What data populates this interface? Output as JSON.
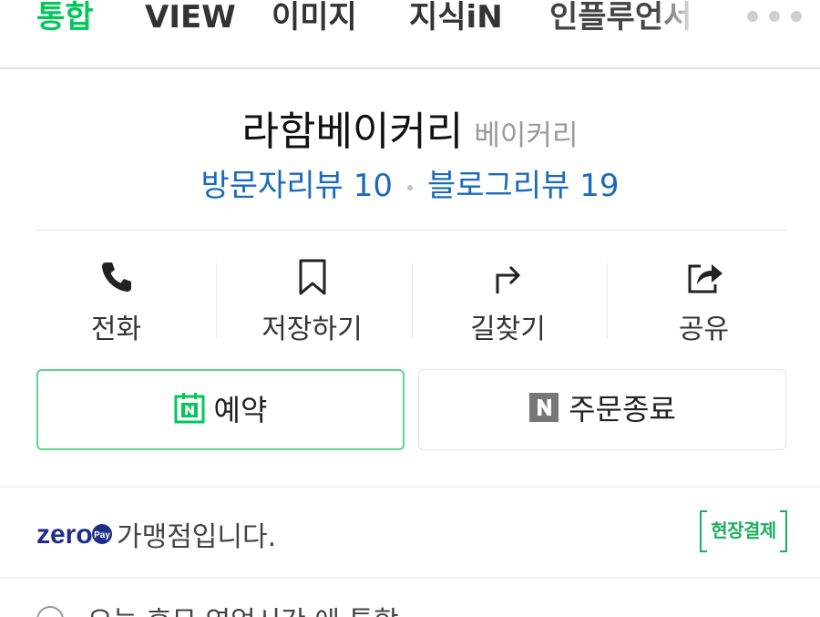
{
  "tabs": [
    {
      "label": "통합",
      "active": true
    },
    {
      "label": "VIEW",
      "active": false
    },
    {
      "label": "이미지",
      "active": false
    },
    {
      "label": "지식iN",
      "active": false
    },
    {
      "label": "인플루언서",
      "active": false
    }
  ],
  "place": {
    "name": "라함베이커리",
    "category": "베이커리",
    "visitor_reviews": "방문자리뷰 10",
    "blog_reviews": "블로그리뷰 19"
  },
  "actions": {
    "call": "전화",
    "save": "저장하기",
    "directions": "길찾기",
    "share": "공유"
  },
  "buttons": {
    "reserve": "예약",
    "order": "주문종료",
    "n_badge": "N"
  },
  "zeropay": {
    "logo": "zero",
    "logo_sub": "Pay",
    "text": "가맹점입니다.",
    "badge": "현장결제"
  },
  "next_row": {
    "text": "오늘 휴무 영업시간 에 통합"
  },
  "colors": {
    "brand_green": "#03c75a",
    "link_blue": "#1a6bb8",
    "zeropay_navy": "#1f2f87"
  },
  "icons": {
    "more": "more-horizontal-icon",
    "call": "phone-icon",
    "save": "bookmark-icon",
    "directions": "turn-arrow-icon",
    "share": "share-icon"
  }
}
